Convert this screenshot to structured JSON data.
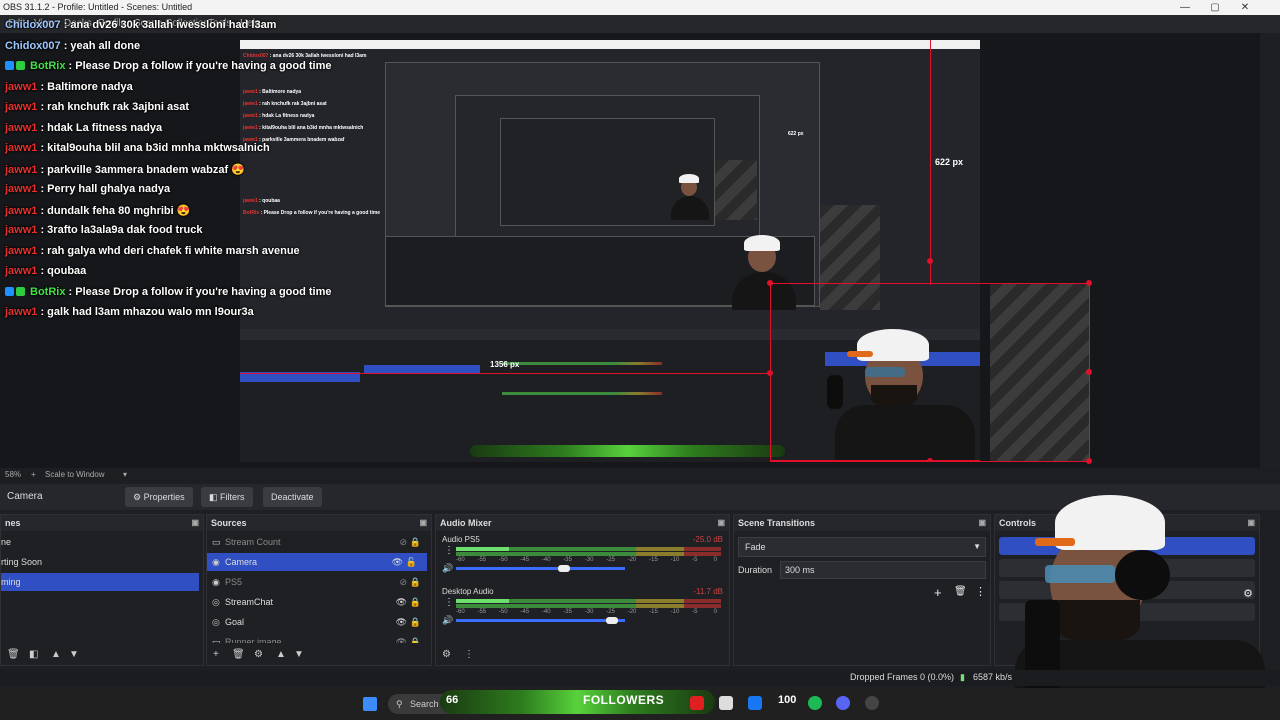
{
  "window": {
    "title": "OBS 31.1.2 - Profile: Untitled - Scenes: Untitled",
    "minimize": "—",
    "maximize": "▢",
    "close": "✕"
  },
  "menu": [
    "Edit",
    "View",
    "Docks",
    "Profile",
    "Scene Collection",
    "Tools",
    "Help"
  ],
  "chat": [
    {
      "user": "Chidox007",
      "user_color": "blue",
      "badges": [],
      "message": " : ana dv26 30k 3allah iwessloni had l3am"
    },
    {
      "user": "Chidox007",
      "user_color": "blue",
      "badges": [],
      "message": " : yeah all done"
    },
    {
      "user": "BotRix",
      "user_color": "green",
      "badges": [
        "#1e90ff",
        "#2ecc40"
      ],
      "message": " : Please Drop a follow if you're having a good time"
    },
    {
      "user": "jaww1",
      "user_color": "red",
      "badges": [],
      "message": " : Baltimore nadya"
    },
    {
      "user": "jaww1",
      "user_color": "red",
      "badges": [],
      "message": " : rah knchufk rak 3ajbni asat"
    },
    {
      "user": "jaww1",
      "user_color": "red",
      "badges": [],
      "message": " : hdak La fitness nadya"
    },
    {
      "user": "jaww1",
      "user_color": "red",
      "badges": [],
      "message": " : kital9ouha blil ana b3id mnha mktwsalnich"
    },
    {
      "user": "jaww1",
      "user_color": "red",
      "badges": [],
      "message": " : parkville 3ammera bnadem wabzaf 😍"
    },
    {
      "user": "jaww1",
      "user_color": "red",
      "badges": [],
      "message": " : Perry hall ghalya nadya"
    },
    {
      "user": "jaww1",
      "user_color": "red",
      "badges": [],
      "message": " : dundalk feha 80 mghribi 😍"
    },
    {
      "user": "jaww1",
      "user_color": "red",
      "badges": [],
      "message": " : 3rafto la3ala9a dak food truck"
    },
    {
      "user": "jaww1",
      "user_color": "red",
      "badges": [],
      "message": " : rah galya whd deri chafek fi white marsh avenue"
    },
    {
      "user": "jaww1",
      "user_color": "red",
      "badges": [],
      "message": " : qoubaa"
    },
    {
      "user": "BotRix",
      "user_color": "green",
      "badges": [
        "#1e90ff",
        "#2ecc40"
      ],
      "message": " : Please Drop a follow if you're having a good time"
    },
    {
      "user": "jaww1",
      "user_color": "red",
      "badges": [],
      "message": " : galk had l3am mhazou walo mn l9our3a"
    }
  ],
  "preview_labels": {
    "height_a": "622 px",
    "height_b": "622 px",
    "width": "1356 px"
  },
  "zoom": {
    "level": "58%",
    "add": "+",
    "mode": "Scale to Window",
    "chevron": "▾"
  },
  "source_toolbar": {
    "selected": "Camera",
    "properties": "Properties",
    "filters": "Filters",
    "deactivate": "Deactivate",
    "properties_icon": "⚙",
    "filters_icon": "◧"
  },
  "scenes": {
    "title": "nes",
    "items": [
      {
        "label": "ne",
        "active": false
      },
      {
        "label": "rting Soon",
        "active": false
      },
      {
        "label": "ming",
        "active": true
      }
    ],
    "footer": [
      "🗑",
      "◧",
      "▲",
      "▼"
    ]
  },
  "sources": {
    "title": "Sources",
    "items": [
      {
        "label": "Stream Count",
        "icon": "▭",
        "eye": "⊘",
        "lock": "🔒",
        "active": false,
        "dim": true
      },
      {
        "label": "Camera",
        "icon": "◉",
        "eye": "👁",
        "lock": "🔓",
        "active": true,
        "dim": false
      },
      {
        "label": "PS5",
        "icon": "◉",
        "eye": "⊘",
        "lock": "🔒",
        "active": false,
        "dim": true
      },
      {
        "label": "StreamChat",
        "icon": "◎",
        "eye": "👁",
        "lock": "🔒",
        "active": false,
        "dim": false
      },
      {
        "label": "Goal",
        "icon": "◎",
        "eye": "👁",
        "lock": "🔒",
        "active": false,
        "dim": false
      },
      {
        "label": "Runner image",
        "icon": "▭",
        "eye": "👁",
        "lock": "🔒",
        "active": false,
        "dim": true
      }
    ],
    "footer": [
      "+",
      "🗑",
      "⚙",
      "▲",
      "▼"
    ]
  },
  "mixer": {
    "title": "Audio Mixer",
    "channels": [
      {
        "name": "Audio PS5",
        "db": "-25.0 dB"
      },
      {
        "name": "Desktop Audio",
        "db": "-11.7 dB"
      }
    ],
    "ticks": [
      "-60",
      "-55",
      "-50",
      "-45",
      "-40",
      "-35",
      "-30",
      "-25",
      "-20",
      "-15",
      "-10",
      "-5",
      "0"
    ],
    "footer": [
      "⚙",
      "⋮"
    ]
  },
  "transitions": {
    "title": "Scene Transitions",
    "selected": "Fade",
    "duration_label": "Duration",
    "duration_value": "300 ms",
    "add": "+",
    "remove": "🗑",
    "more": "⋮"
  },
  "controls": {
    "title": "Controls",
    "settings_icon": "⚙"
  },
  "status": {
    "dropped": "Dropped Frames 0 (0.0%)",
    "bitrate": "6587 kb/s"
  },
  "taskbar": {
    "search": "Search",
    "followers_count": "66",
    "followers_label": "FOLLOWERS",
    "badge_100": "100"
  },
  "colors": {
    "accent": "#2f4fc2",
    "selection_red": "#e0102a",
    "chat_user_red": "#e8312f",
    "chat_user_blue": "#9ec7ff",
    "bot_green": "#43e04a"
  }
}
